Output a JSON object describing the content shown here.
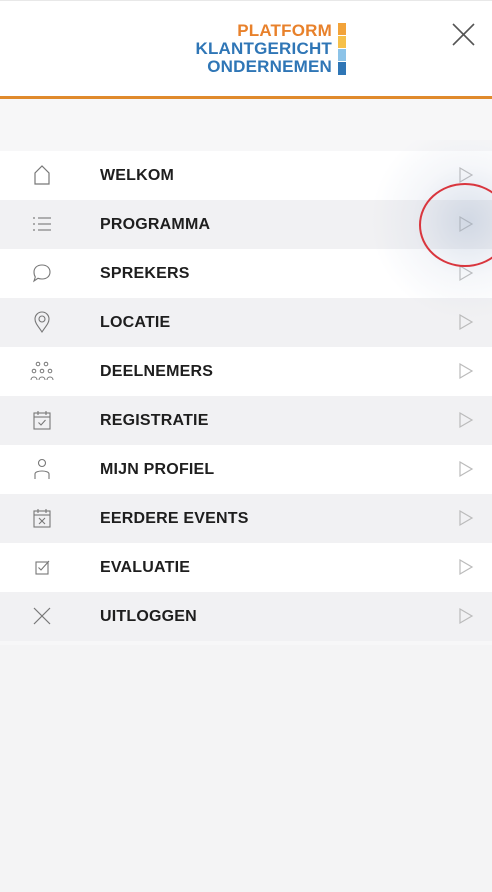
{
  "header": {
    "logo_line1": "PLATFORM",
    "logo_line2": "KLANTGERICHT",
    "logo_line3": "ONDERNEMEN",
    "close_icon": "close-icon",
    "accent_color": "#e08a2c",
    "brand_blue": "#2f76b6",
    "brand_orange": "#e8812b"
  },
  "menu": {
    "items": [
      {
        "label": "WELKOM",
        "icon": "home-icon"
      },
      {
        "label": "PROGRAMMA",
        "icon": "list-icon"
      },
      {
        "label": "SPREKERS",
        "icon": "speech-bubble-icon"
      },
      {
        "label": "LOCATIE",
        "icon": "location-pin-icon"
      },
      {
        "label": "DEELNEMERS",
        "icon": "group-icon"
      },
      {
        "label": "REGISTRATIE",
        "icon": "calendar-check-icon"
      },
      {
        "label": "MIJN PROFIEL",
        "icon": "user-icon"
      },
      {
        "label": "EERDERE EVENTS",
        "icon": "calendar-x-icon"
      },
      {
        "label": "EVALUATIE",
        "icon": "checkbox-icon"
      },
      {
        "label": "UITLOGGEN",
        "icon": "logout-x-icon"
      }
    ],
    "arrow_icon": "play-arrow-icon",
    "highlight_color": "#d9363e"
  }
}
